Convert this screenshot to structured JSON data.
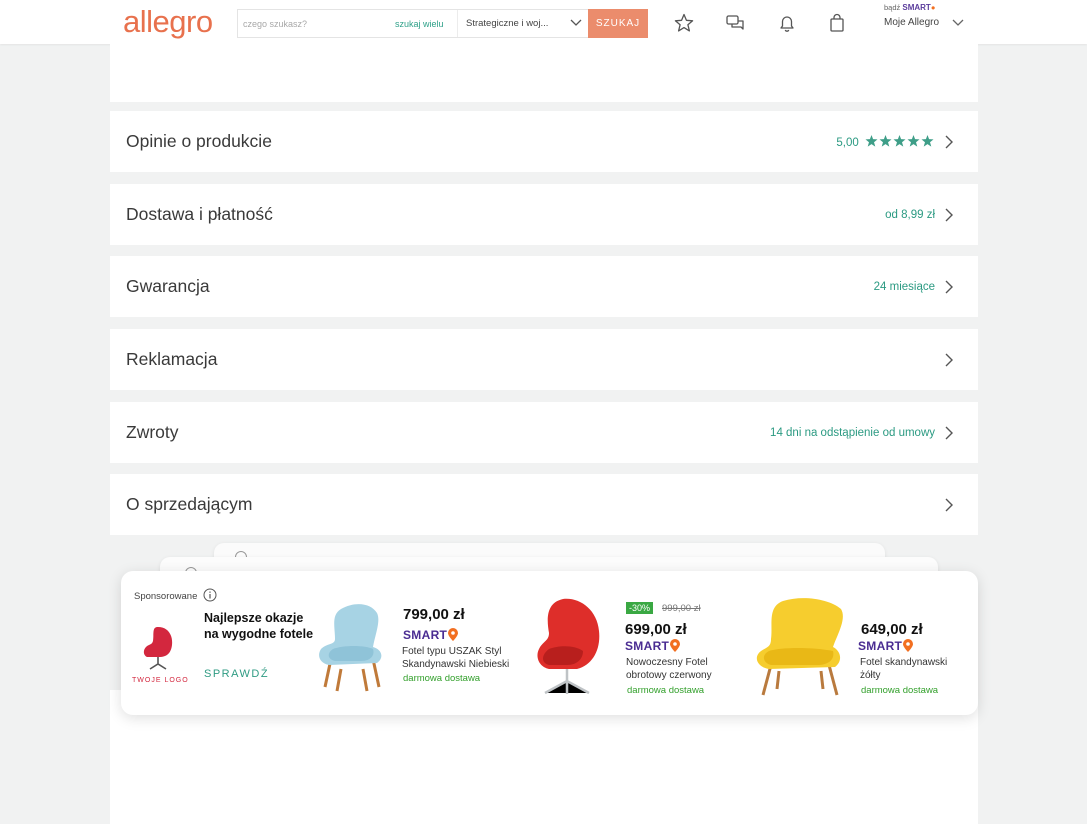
{
  "header": {
    "logo": "allegro",
    "search": {
      "placeholder": "czego szukasz?",
      "many_link": "szukaj wielu",
      "category": "Strategiczne i woj...",
      "button": "SZUKAJ"
    },
    "smart_prefix": "bądź",
    "smart_label": "SMART",
    "account_label": "Moje Allegro"
  },
  "rows": [
    {
      "title": "Opinie o produkcie",
      "value": "5,00",
      "stars": 5
    },
    {
      "title": "Dostawa i płatność",
      "value": "od 8,99 zł"
    },
    {
      "title": "Gwarancja",
      "value": "24 miesiące"
    },
    {
      "title": "Reklamacja",
      "value": ""
    },
    {
      "title": "Zwroty",
      "value": "14 dni na odstąpienie od umowy"
    },
    {
      "title": "O sprzedającym",
      "value": ""
    }
  ],
  "ad": {
    "sponsored": "Sponsorowane",
    "brand": "TWOJE LOGO",
    "headline": "Najlepsze okazje na wygodne fotele",
    "cta": "SPRAWDŹ",
    "products": [
      {
        "price": "799,00 zł",
        "smart": "SMART",
        "name": "Fotel typu USZAK Styl Skandynawski Niebieski",
        "shipping": "darmowa dostawa"
      },
      {
        "discount": "-30%",
        "old_price": "999,00 zł",
        "price": "699,00 zł",
        "smart": "SMART",
        "name": "Nowoczesny Fotel obrotowy czerwony",
        "shipping": "darmowa dostawa"
      },
      {
        "price": "649,00 zł",
        "smart": "SMART",
        "name": "Fotel skandynawski żółty",
        "shipping": "darmowa dostawa"
      }
    ]
  },
  "colors": {
    "brand": "#e8714d",
    "accent_teal": "#2b9a82",
    "smart_purple": "#4a2c92",
    "shipping_green": "#33a02c"
  },
  "icons": [
    "star-icon",
    "chat-icon",
    "bell-icon",
    "bag-icon",
    "chevron-right-icon",
    "info-icon"
  ]
}
